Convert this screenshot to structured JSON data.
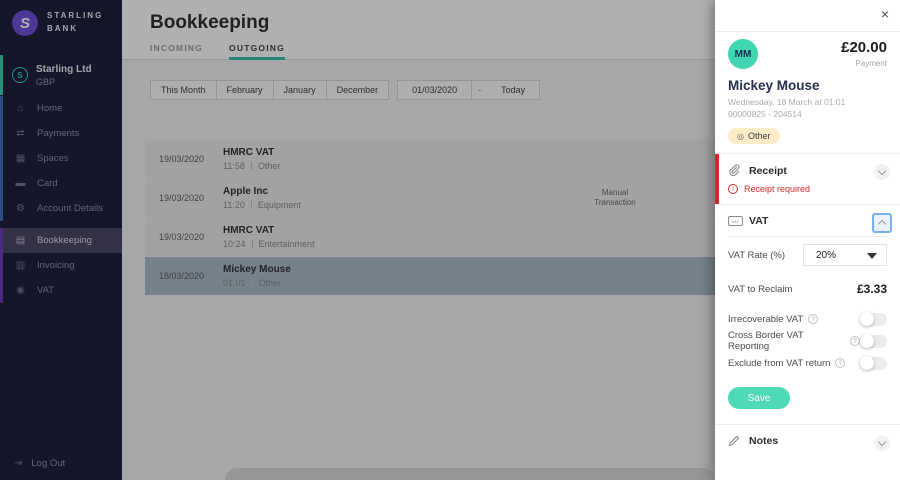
{
  "colors": {
    "accent_teal": "#33c3a3",
    "avatar_teal": "#41d6b2",
    "save_teal": "#4ed9b7",
    "alert_red": "#cf2a2a",
    "brand_purple": "#6b4fd8",
    "sidebar_bg": "#1c1c38",
    "selected_row": "#a9bbc5",
    "chip_bg": "#fcecc8",
    "focus_blue": "#79b0ec"
  },
  "sidebar": {
    "brand": {
      "initial": "S",
      "line1": "STARLING",
      "line2": "BANK"
    },
    "account": {
      "icon": "S",
      "name": "Starling Ltd",
      "currency": "GBP"
    },
    "nav_primary": [
      {
        "icon": "⌂",
        "label": "Home"
      },
      {
        "icon": "⇄",
        "label": "Payments"
      },
      {
        "icon": "▦",
        "label": "Spaces"
      },
      {
        "icon": "▬",
        "label": "Card"
      },
      {
        "icon": "⚙",
        "label": "Account Details"
      }
    ],
    "nav_secondary": [
      {
        "icon": "▤",
        "label": "Bookkeeping"
      },
      {
        "icon": "▥",
        "label": "Invoicing"
      },
      {
        "icon": "◉",
        "label": "VAT"
      }
    ],
    "logout": {
      "icon": "⇥",
      "label": "Log Out"
    }
  },
  "header": {
    "title": "Bookkeeping",
    "tabs": [
      {
        "label": "INCOMING"
      },
      {
        "label": "OUTGOING"
      }
    ]
  },
  "filters": {
    "presets": [
      "This Month",
      "February",
      "January",
      "December"
    ],
    "date_from": "01/03/2020",
    "separator": "-",
    "date_to": "Today"
  },
  "transactions": [
    {
      "date": "19/03/2020",
      "name": "HMRC VAT",
      "time": "11:58",
      "category": "Other",
      "note": ""
    },
    {
      "date": "19/03/2020",
      "name": "Apple Inc",
      "time": "11:20",
      "category": "Equipment",
      "note": "Manual\nTransaction"
    },
    {
      "date": "19/03/2020",
      "name": "HMRC VAT",
      "time": "10:24",
      "category": "Entertainment",
      "note": ""
    },
    {
      "date": "18/03/2020",
      "name": "Mickey Mouse",
      "time": "01:01",
      "category": "Other",
      "note": ""
    }
  ],
  "panel": {
    "close": "×",
    "initials": "MM",
    "amount": "£20.00",
    "amount_type": "Payment",
    "name": "Mickey Mouse",
    "datetime": "Wednesday, 18 March at 01:01",
    "reference": "00000825 - 204514",
    "category_badge": {
      "icon": "◎",
      "label": "Other"
    },
    "receipt": {
      "title": "Receipt",
      "warning_icon": "!",
      "warning": "Receipt required"
    },
    "vat": {
      "badge": "VAT",
      "title": "VAT",
      "rate_label": "VAT Rate (%)",
      "rate_value": "20%",
      "reclaim_label": "VAT to Reclaim",
      "reclaim_value": "£3.33",
      "info_glyph": "?",
      "toggles": [
        {
          "label": "Irrecoverable VAT",
          "state": "off"
        },
        {
          "label": "Cross Border VAT Reporting",
          "state": "off"
        },
        {
          "label": "Exclude from VAT return",
          "state": "off"
        }
      ],
      "save_label": "Save"
    },
    "notes": {
      "title": "Notes"
    }
  }
}
